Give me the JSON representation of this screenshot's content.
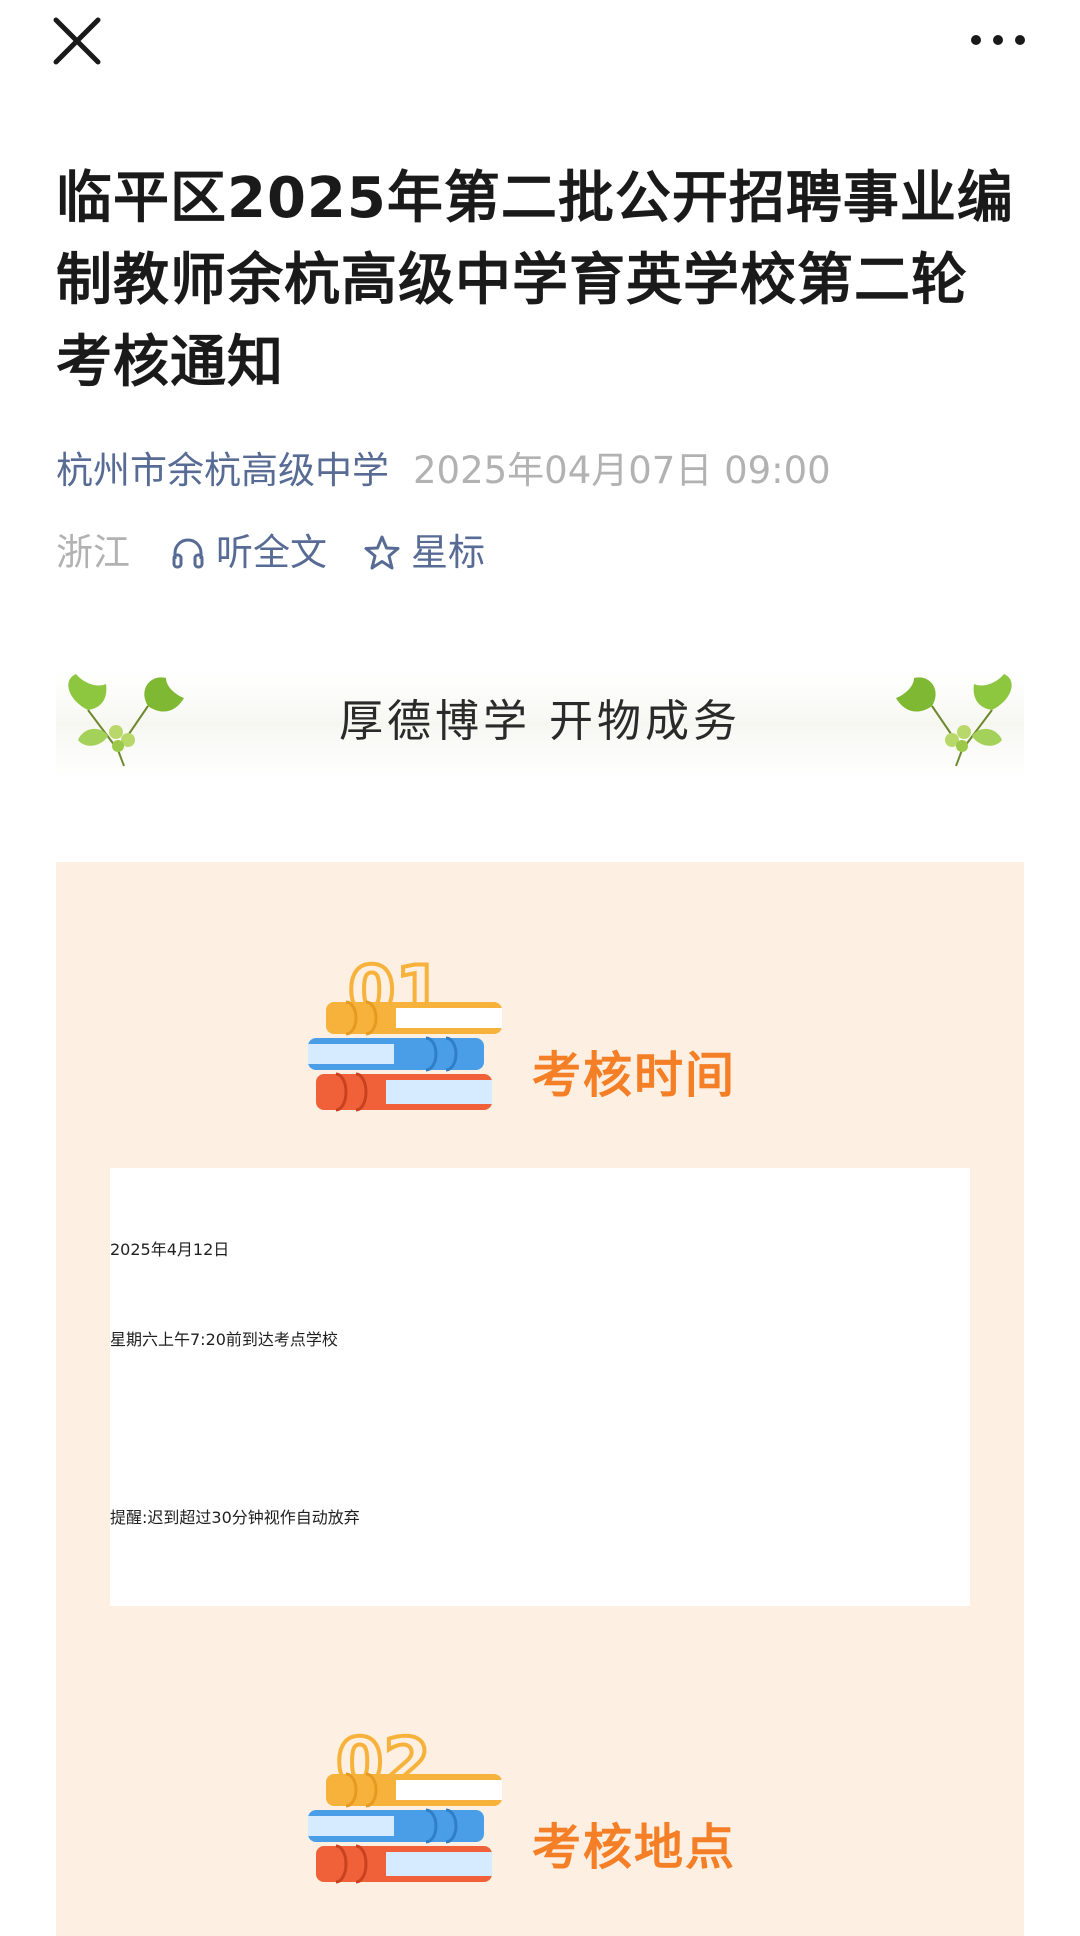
{
  "nav": {
    "close_icon": "close-icon",
    "more_icon": "more-dots-icon"
  },
  "article": {
    "title": "临平区2025年第二批公开招聘事业编制教师余杭高级中学育英学校第二轮考核通知",
    "account_name": "杭州市余杭高级中学",
    "publish_time": "2025年04月07日 09:00",
    "location": "浙江",
    "listen_label": "听全文",
    "listen_icon": "headphones-icon",
    "star_label": "星标",
    "star_icon": "star-outline-icon"
  },
  "banner": {
    "motto": "厚德博学 开物成务",
    "decoration_icon": "ginkgo-leaf-icon"
  },
  "sections": [
    {
      "number": "01",
      "title": "考核时间",
      "icon": "stacked-books-icon",
      "lines": [
        "2025年4月12日",
        "星期六上午7:20前到达考点学校",
        "提醒:迟到超过30分钟视作自动放弃"
      ]
    },
    {
      "number": "02",
      "title": "考核地点",
      "icon": "stacked-books-icon"
    }
  ],
  "colors": {
    "link": "#576b95",
    "meta_gray": "#b2b2b2",
    "accent_orange": "#f47f26",
    "panel_bg": "#fdefe1",
    "book_yellow": "#f7b23b",
    "book_blue": "#4a9ee8",
    "book_red": "#f0613a"
  }
}
